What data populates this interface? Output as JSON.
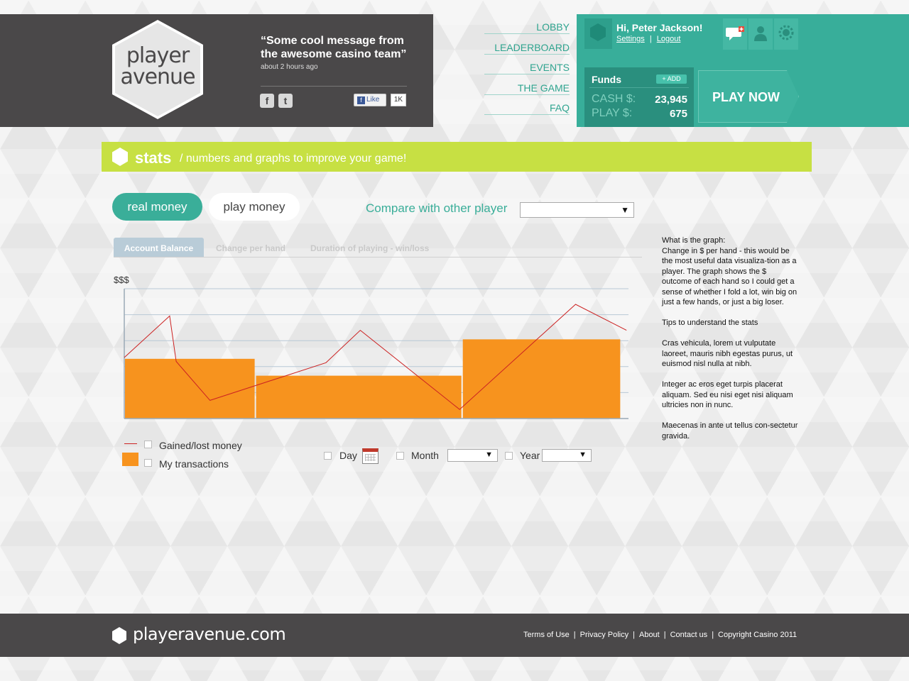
{
  "brand": {
    "logo_line1": "player",
    "logo_line2": "avenue",
    "footer_name": "playeravenue.com"
  },
  "message": {
    "quote": "“Some cool message from the awesome casino team”",
    "time": "about 2 hours ago",
    "facebook_icon": "f",
    "twitter_icon": "t",
    "like_label": "Like",
    "like_count": "1K"
  },
  "nav": {
    "items": [
      "LOBBY",
      "LEADERBOARD",
      "EVENTS",
      "THE GAME",
      "FAQ"
    ]
  },
  "account": {
    "greeting": "Hi, Peter Jackson!",
    "settings_label": "Settings",
    "link_separator": "|",
    "logout_label": "Logout",
    "icons": [
      "chat-icon",
      "user-icon",
      "chip-icon"
    ],
    "funds_title": "Funds",
    "add_label": "+ ADD",
    "cash_label": "CASH $:",
    "cash_value": "23,945",
    "play_label": "PLAY $:",
    "play_value": "675",
    "play_now": "PLAY NOW"
  },
  "stats": {
    "title": "stats",
    "subtitle": "/ numbers and graphs to improve your game!"
  },
  "toggles": {
    "real": "real money",
    "play": "play money",
    "compare_label": "Compare with other player",
    "compare_value": ""
  },
  "tabs": [
    {
      "label": "Account Balance",
      "active": true
    },
    {
      "label": "Change per hand",
      "active": false
    },
    {
      "label": "Duration of playing - win/loss",
      "active": false
    }
  ],
  "chart_data": {
    "type": "bar+line",
    "ylabel": "$$$",
    "ylim": [
      0,
      5
    ],
    "grid": true,
    "bars": [
      {
        "x0": 0,
        "x1": 0.26,
        "value": 2.3
      },
      {
        "x0": 0.26,
        "x1": 0.67,
        "value": 1.65
      },
      {
        "x0": 0.67,
        "x1": 0.985,
        "value": 3.05
      }
    ],
    "line": [
      [
        0,
        2.35
      ],
      [
        0.09,
        3.95
      ],
      [
        0.103,
        2.2
      ],
      [
        0.17,
        0.7
      ],
      [
        0.4,
        2.15
      ],
      [
        0.468,
        3.4
      ],
      [
        0.665,
        0.35
      ],
      [
        0.895,
        4.4
      ],
      [
        0.996,
        3.4
      ]
    ],
    "bar_color": "#f7931e",
    "line_color": "#cc2222"
  },
  "legend": {
    "line_label": "Gained/lost money",
    "bar_label": "My transactions"
  },
  "controls": {
    "day": "Day",
    "month": "Month",
    "year": "Year",
    "month_value": "",
    "year_value": ""
  },
  "help": {
    "paragraphs": [
      "What is the graph:\nChange in $ per hand - this would be the most useful data visualiza-tion as a player.  The graph shows the $ outcome of each hand so I could get a sense of whether I fold a lot, win big on just a few hands, or just a big loser.",
      "Tips to understand the stats",
      "Cras vehicula, lorem ut vulputate laoreet, mauris nibh egestas purus, ut euismod nisl nulla at nibh.",
      "Integer ac eros eget turpis placerat aliquam. Sed eu nisi eget nisi aliquam ultricies non in nunc.",
      "Maecenas in ante ut tellus con-sectetur gravida."
    ]
  },
  "footer": {
    "links": [
      "Terms of Use",
      "Privacy Policy",
      "About",
      "Contact us",
      "Copyright Casino 2011"
    ],
    "separator": "|"
  },
  "colors": {
    "teal": "#38ae9a",
    "dark": "#4a4849",
    "lime": "#c7e043",
    "orange": "#f7931e"
  }
}
